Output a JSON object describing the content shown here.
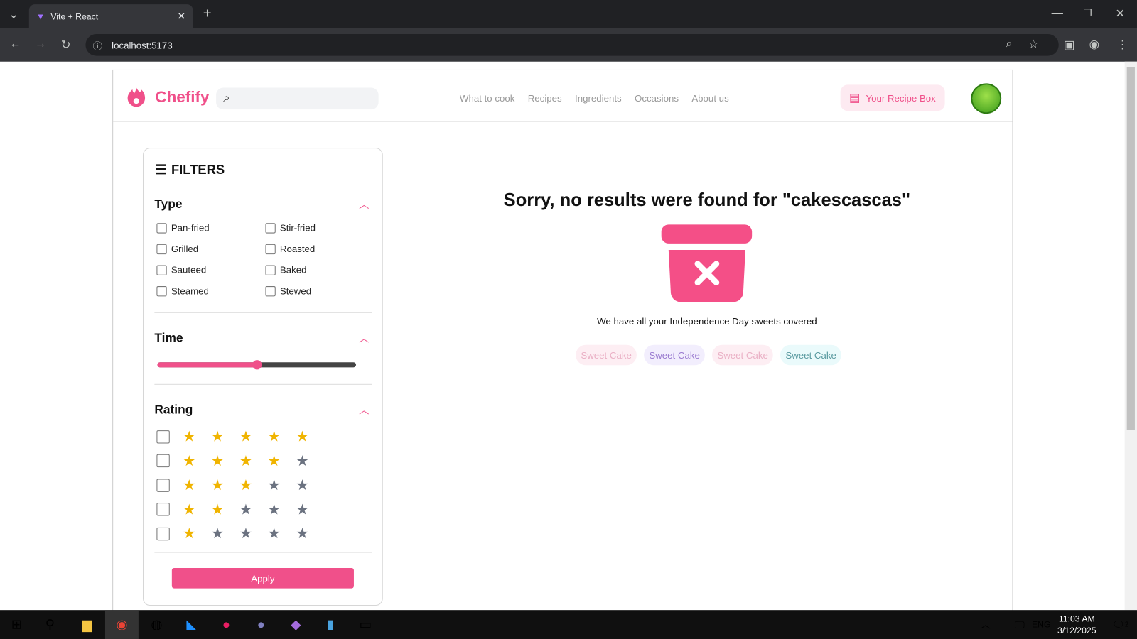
{
  "browser": {
    "tab_title": "Vite + React",
    "url": "localhost:5173"
  },
  "header": {
    "brand": "Chefify",
    "search_placeholder": "",
    "nav": [
      "What to cook",
      "Recipes",
      "Ingredients",
      "Occasions",
      "About us"
    ],
    "recipe_box": "Your Recipe Box"
  },
  "filters": {
    "title": "FILTERS",
    "type_label": "Type",
    "types": [
      "Pan-fried",
      "Stir-fried",
      "Grilled",
      "Roasted",
      "Sauteed",
      "Baked",
      "Steamed",
      "Stewed"
    ],
    "time_label": "Time",
    "time_value_fraction": 0.5,
    "rating_label": "Rating",
    "ratings": [
      5,
      4,
      3,
      2,
      1
    ],
    "apply": "Apply"
  },
  "results": {
    "message": "Sorry, no results were found for \"cakescascas\"",
    "subtitle": "We have all your Independence Day sweets covered",
    "suggestions": [
      {
        "label": "Sweet Cake",
        "bg": "#fdeef3",
        "fg": "#eab0c5"
      },
      {
        "label": "Sweet Cake",
        "bg": "#f2eefd",
        "fg": "#9a7bd0"
      },
      {
        "label": "Sweet Cake",
        "bg": "#fdeef3",
        "fg": "#eab0c5"
      },
      {
        "label": "Sweet Cake",
        "bg": "#eafafb",
        "fg": "#5a9aa0"
      }
    ]
  },
  "colors": {
    "accent": "#f0508a",
    "star_on": "#f0b400",
    "star_off": "#6b7280"
  },
  "taskbar": {
    "lang": "ENG",
    "time": "11:03 AM",
    "date": "3/12/2025",
    "notifications": "2"
  }
}
